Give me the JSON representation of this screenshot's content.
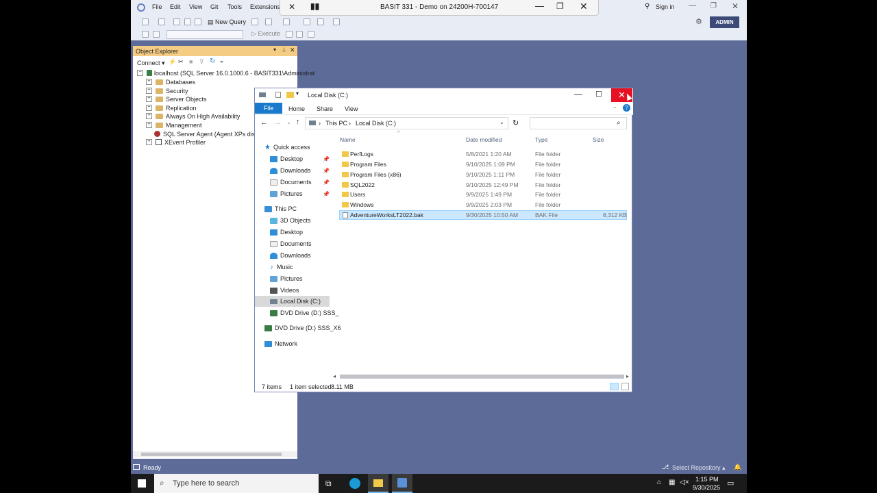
{
  "ssms": {
    "menu": [
      "File",
      "Edit",
      "View",
      "Git",
      "Tools",
      "Extensions"
    ],
    "sign_in": "Sign in",
    "admin_badge": "ADMIN",
    "new_query": "New Query",
    "execute": "Execute",
    "status": "Ready",
    "select_repository": "Select Repository"
  },
  "rdp": {
    "title": "BASIT 331 - Demo on 24200H-700147"
  },
  "object_explorer": {
    "title": "Object Explorer",
    "connect": "Connect",
    "server": "localhost (SQL Server 16.0.1000.6 - BASIT331\\Administrat",
    "nodes": [
      "Databases",
      "Security",
      "Server Objects",
      "Replication",
      "Always On High Availability",
      "Management",
      "SQL Server Agent (Agent XPs disabl",
      "XEvent Profiler"
    ]
  },
  "explorer": {
    "title": "Local Disk (C:)",
    "tabs": [
      "File",
      "Home",
      "Share",
      "View"
    ],
    "breadcrumb": [
      "This PC",
      "Local Disk (C:)"
    ],
    "columns": {
      "name": "Name",
      "date": "Date modified",
      "type": "Type",
      "size": "Size"
    },
    "nav": {
      "quick_access": "Quick access",
      "quick": [
        "Desktop",
        "Downloads",
        "Documents",
        "Pictures"
      ],
      "this_pc": "This PC",
      "pc": [
        "3D Objects",
        "Desktop",
        "Documents",
        "Downloads",
        "Music",
        "Pictures",
        "Videos",
        "Local Disk (C:)",
        "DVD Drive (D:) SSS_"
      ],
      "dvd": "DVD Drive (D:) SSS_X6",
      "network": "Network"
    },
    "files": [
      {
        "name": "PerfLogs",
        "date": "5/8/2021 1:20 AM",
        "type": "File folder",
        "size": ""
      },
      {
        "name": "Program Files",
        "date": "9/10/2025 1:09 PM",
        "type": "File folder",
        "size": ""
      },
      {
        "name": "Program Files (x86)",
        "date": "9/10/2025 1:11 PM",
        "type": "File folder",
        "size": ""
      },
      {
        "name": "SQL2022",
        "date": "9/10/2025 12:49 PM",
        "type": "File folder",
        "size": ""
      },
      {
        "name": "Users",
        "date": "9/9/2025 1:49 PM",
        "type": "File folder",
        "size": ""
      },
      {
        "name": "Windows",
        "date": "9/9/2025 2:03 PM",
        "type": "File folder",
        "size": ""
      },
      {
        "name": "AdventureWorksLT2022.bak",
        "date": "9/30/2025 10:50 AM",
        "type": "BAK File",
        "size": "8,312 KB"
      }
    ],
    "status_items": "7 items",
    "status_selected": "1 item selected",
    "status_size": "8.11 MB"
  },
  "taskbar": {
    "search_placeholder": "Type here to search",
    "time": "1:15 PM",
    "date": "9/30/2025"
  },
  "colors": {
    "ssms_bg": "#5d6b99",
    "accent_blue": "#1979ca",
    "close_red": "#e81123",
    "oe_title": "#f5cc84",
    "selection": "#cce8ff"
  }
}
